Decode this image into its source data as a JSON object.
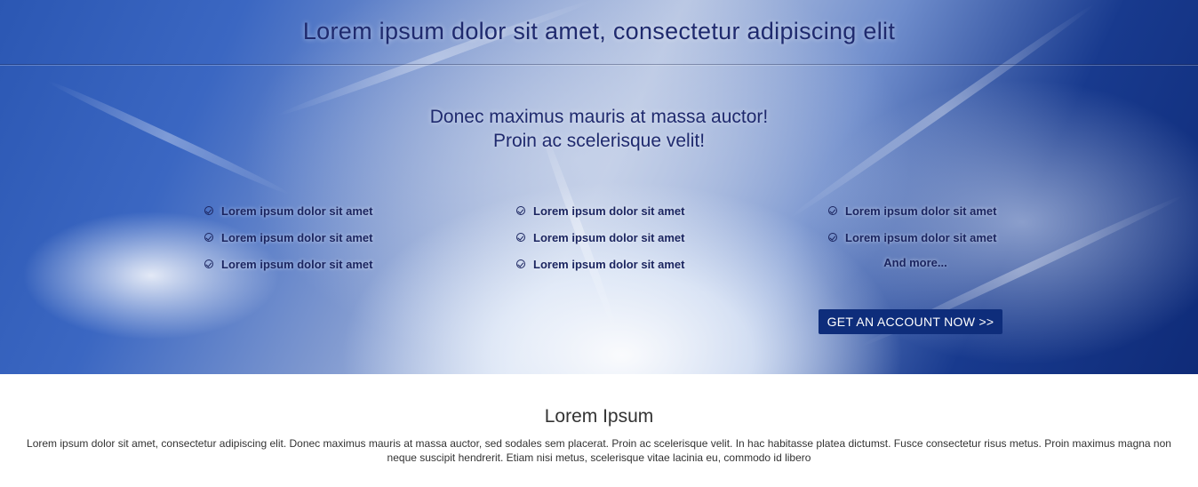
{
  "header": {
    "title": "Lorem ipsum dolor sit amet, consectetur adipiscing elit"
  },
  "hero": {
    "tagline_line1": "Donec maximus mauris at massa auctor!",
    "tagline_line2": "Proin ac scelerisque velit!",
    "features": {
      "col1": [
        "Lorem ipsum dolor sit amet",
        "Lorem ipsum dolor sit amet",
        "Lorem ipsum dolor sit amet"
      ],
      "col2": [
        "Lorem ipsum dolor sit amet",
        "Lorem ipsum dolor sit amet",
        "Lorem ipsum dolor sit amet"
      ],
      "col3": [
        "Lorem ipsum dolor sit amet",
        "Lorem ipsum dolor sit amet"
      ]
    },
    "more_label": "And more...",
    "cta_label": "GET AN ACCOUNT NOW >>",
    "icon": "check-circle-icon",
    "colors": {
      "text": "#1b2560",
      "button": "#0e2d7b"
    }
  },
  "content": {
    "title": "Lorem Ipsum",
    "text": "Lorem ipsum dolor sit amet, consectetur adipiscing elit. Donec maximus mauris at massa auctor, sed sodales sem placerat. Proin ac scelerisque velit. In hac habitasse platea dictumst. Fusce consectetur risus metus. Proin maximus magna non neque suscipit hendrerit. Etiam nisi metus, scelerisque vitae lacinia eu, commodo id libero"
  }
}
